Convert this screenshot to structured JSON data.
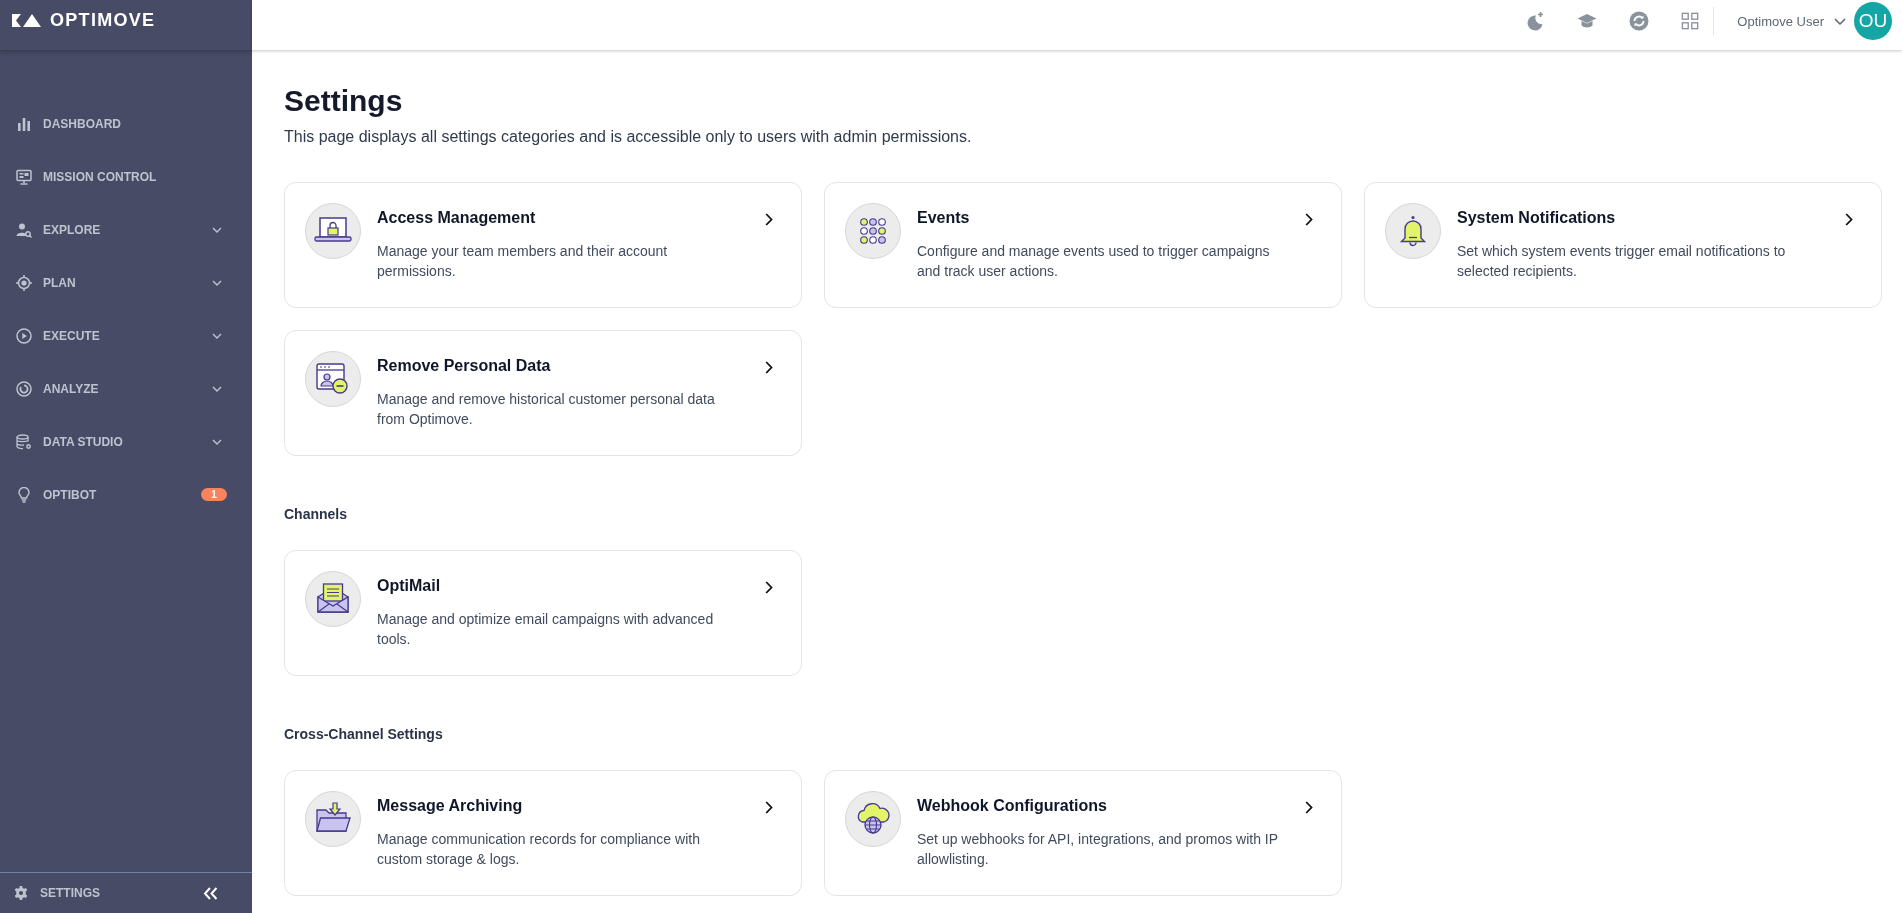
{
  "logo": {
    "text": "OPTIMOVE"
  },
  "sidebar": {
    "items": [
      {
        "label": "DASHBOARD",
        "kind": "link"
      },
      {
        "label": "MISSION CONTROL",
        "kind": "link"
      },
      {
        "label": "EXPLORE",
        "kind": "group"
      },
      {
        "label": "PLAN",
        "kind": "group"
      },
      {
        "label": "EXECUTE",
        "kind": "group"
      },
      {
        "label": "ANALYZE",
        "kind": "group"
      },
      {
        "label": "DATA STUDIO",
        "kind": "group"
      },
      {
        "label": "OPTIBOT",
        "kind": "link",
        "badge": "1"
      }
    ],
    "footer": {
      "label": "SETTINGS"
    }
  },
  "header": {
    "user": {
      "name": "Optimove User",
      "initials": "OU"
    }
  },
  "page": {
    "title": "Settings",
    "description": "This page displays all settings categories and is accessible only to users with admin permissions.",
    "sections": [
      {
        "cards": [
          {
            "title": "Access Management",
            "description": "Manage your team members and their account permissions."
          },
          {
            "title": "Events",
            "description": "Configure and manage events used to trigger campaigns and track user actions."
          },
          {
            "title": "System Notifications",
            "description": "Set which system events trigger email notifications to selected recipients."
          },
          {
            "title": "Remove Personal Data",
            "description": "Manage and remove historical customer personal data from Optimove."
          }
        ]
      },
      {
        "heading": "Channels",
        "cards": [
          {
            "title": "OptiMail",
            "description": "Manage and optimize email campaigns with advanced tools."
          }
        ]
      },
      {
        "heading": "Cross-Channel Settings",
        "cards": [
          {
            "title": "Message Archiving",
            "description": "Manage communication records for compliance with custom storage & logs."
          },
          {
            "title": "Webhook Configurations",
            "description": "Set up webhooks for API, integrations, and promos with IP allowlisting."
          }
        ]
      }
    ]
  }
}
